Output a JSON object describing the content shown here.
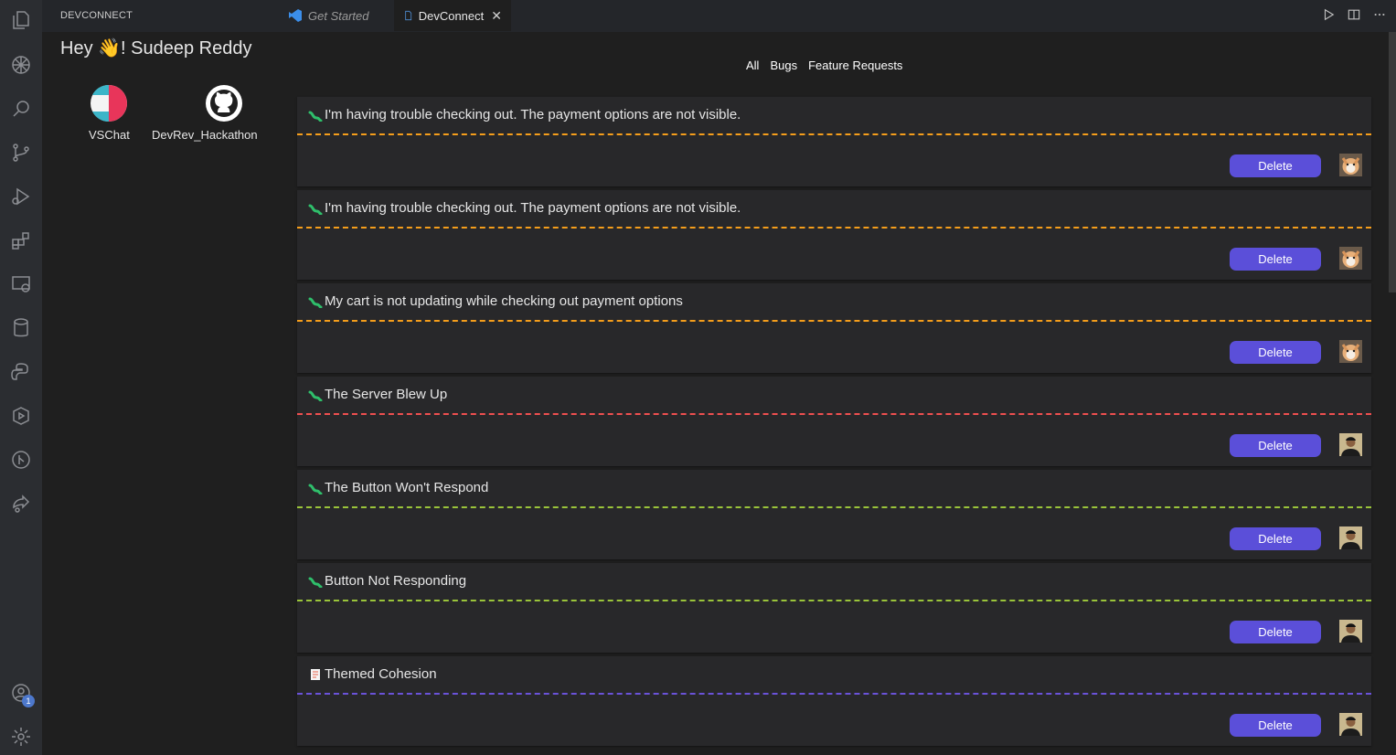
{
  "panel": {
    "title": "DEVCONNECT"
  },
  "tabs": [
    {
      "label": "Get Started"
    },
    {
      "label": "DevConnect",
      "close": "✕"
    }
  ],
  "greeting": {
    "prefix": "Hey ",
    "emoji": "👋",
    "suffix": "! Sudeep Reddy"
  },
  "apps": [
    {
      "label": "VSChat"
    },
    {
      "label": "DevRev_Hackathon"
    }
  ],
  "filters": [
    "All",
    "Bugs",
    "Feature Requests"
  ],
  "activity_bar": {
    "badge": "1",
    "icons": [
      "explorer-icon",
      "settings-sync-icon",
      "search-icon",
      "source-control-icon",
      "run-debug-icon",
      "extensions-icon",
      "remote-explorer-icon",
      "database-icon",
      "python-icon",
      "testing-icon",
      "git-graph-icon",
      "live-share-icon",
      "accounts-icon",
      "settings-gear-icon"
    ]
  },
  "tickets": [
    {
      "title": "I'm having trouble checking out. The payment options are not visible.",
      "type": "bug",
      "color": "#f59e1b",
      "button": "Delete",
      "avatar": "shiba"
    },
    {
      "title": "I'm having trouble checking out. The payment options are not visible.",
      "type": "bug",
      "color": "#f59e1b",
      "button": "Delete",
      "avatar": "shiba"
    },
    {
      "title": "My cart is not updating while checking out payment options",
      "type": "bug",
      "color": "#f59e1b",
      "button": "Delete",
      "avatar": "shiba"
    },
    {
      "title": "The Server Blew Up",
      "type": "bug",
      "color": "#ef4f4f",
      "button": "Delete",
      "avatar": "person"
    },
    {
      "title": "The Button Won't Respond",
      "type": "bug",
      "color": "#9ac43a",
      "button": "Delete",
      "avatar": "person"
    },
    {
      "title": "Button Not Responding",
      "type": "bug",
      "color": "#9ac43a",
      "button": "Delete",
      "avatar": "person"
    },
    {
      "title": "Themed Cohesion",
      "type": "feature",
      "color": "#6a52d9",
      "button": "Delete",
      "avatar": "person"
    }
  ]
}
